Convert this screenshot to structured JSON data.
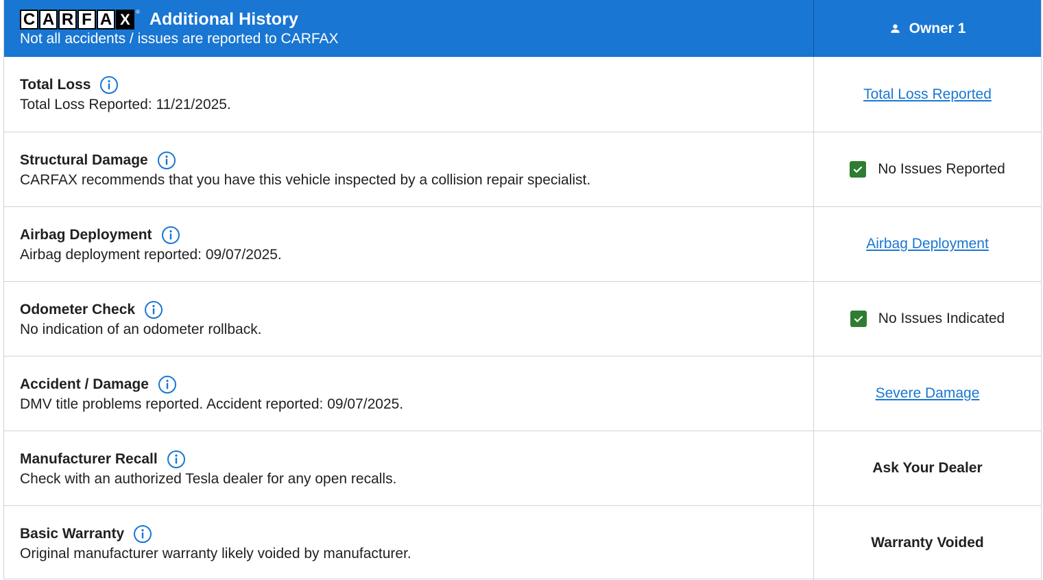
{
  "header": {
    "logo_letters": [
      "C",
      "A",
      "R",
      "F",
      "A",
      "X"
    ],
    "logo_reg": "®",
    "title": "Additional History",
    "subtitle": "Not all accidents / issues are reported to CARFAX",
    "owner_label": "Owner 1"
  },
  "colors": {
    "header_bg": "#1976d2",
    "link": "#1976d2",
    "check_green": "#2e7d32",
    "border": "#cfd4d9"
  },
  "rows": [
    {
      "title": "Total Loss",
      "description": "Total Loss Reported: 11/21/2025.",
      "status_type": "link",
      "status": "Total Loss Reported"
    },
    {
      "title": "Structural Damage",
      "description": "CARFAX recommends that you have this vehicle inspected by a collision repair specialist.",
      "status_type": "check",
      "status": "No Issues Reported"
    },
    {
      "title": "Airbag Deployment",
      "description": "Airbag deployment reported: 09/07/2025.",
      "status_type": "link",
      "status": "Airbag Deployment"
    },
    {
      "title": "Odometer Check",
      "description": "No indication of an odometer rollback.",
      "status_type": "check",
      "status": "No Issues Indicated"
    },
    {
      "title": "Accident / Damage",
      "description": "DMV title problems reported. Accident reported: 09/07/2025.",
      "status_type": "link",
      "status": "Severe Damage"
    },
    {
      "title": "Manufacturer Recall",
      "description": "Check with an authorized Tesla dealer for any open recalls.",
      "status_type": "bold",
      "status": "Ask Your Dealer"
    },
    {
      "title": "Basic Warranty",
      "description": "Original manufacturer warranty likely voided by manufacturer.",
      "status_type": "bold",
      "status": "Warranty Voided"
    }
  ],
  "icons": {
    "info": "info-circle-icon",
    "check": "checkmark-icon",
    "owner": "person-icon"
  }
}
